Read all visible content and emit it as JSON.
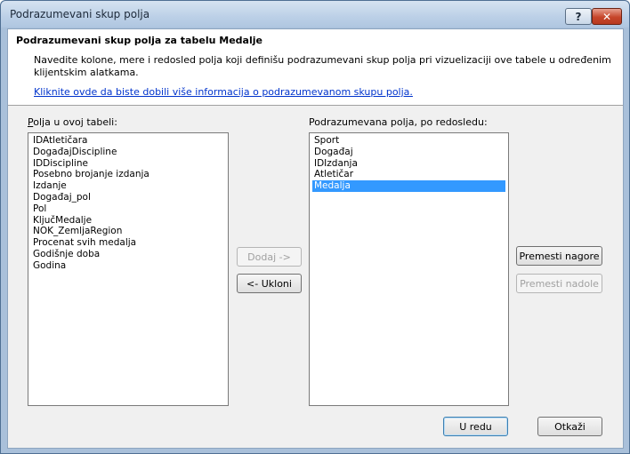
{
  "window": {
    "title": "Podrazumevani skup polja"
  },
  "header": {
    "title": "Podrazumevani skup polja za tabelu Medalje",
    "description": "Navedite kolone, mere i redosled polja koji definišu podrazumevani skup polja pri vizuelizaciji ove tabele u određenim klijentskim alatkama.",
    "link": "Kliknite ovde da biste dobili više informacija o podrazumevanom skupu polja."
  },
  "left_list": {
    "label_mnemonic": "P",
    "label_rest": "olja u ovoj tabeli:",
    "items": [
      "IDAtletičara",
      "DogađajDiscipline",
      "IDDiscipline",
      "Posebno brojanje izdanja",
      "Izdanje",
      "Događaj_pol",
      "Pol",
      "KljučMedalje",
      "NOK_ZemljaRegion",
      "Procenat svih medalja",
      "Godišnje doba",
      "Godina"
    ]
  },
  "right_list": {
    "label": "Podrazumevana polja, po redosledu:",
    "items": [
      "Sport",
      "Događaj",
      "IDIzdanja",
      "Atletičar",
      "Medalja"
    ],
    "selected_index": 4
  },
  "buttons": {
    "add": "Dodaj ->",
    "remove": "<- Ukloni",
    "move_up": "Premesti nagore",
    "move_down": "Premesti nadole",
    "ok": "U redu",
    "cancel": "Otkaži"
  },
  "icons": {
    "help": "help-icon",
    "close": "close-icon"
  }
}
